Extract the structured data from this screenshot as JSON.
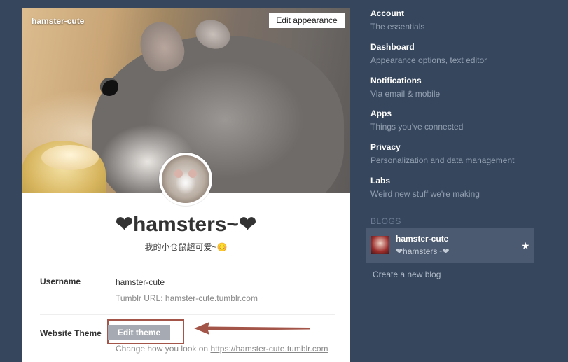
{
  "blog_card": {
    "header_name": "hamster-cute",
    "edit_appearance_label": "Edit appearance",
    "title": "❤hamsters~❤",
    "description": "我的小仓鼠超可爱~😊",
    "username_label": "Username",
    "username_value": "hamster-cute",
    "tumblr_url_prefix": "Tumblr URL: ",
    "tumblr_url": "hamster-cute.tumblr.com",
    "theme_label": "Website Theme",
    "edit_theme_label": "Edit theme",
    "theme_sub_prefix": "Change how you look on ",
    "theme_sub_link": "https://hamster-cute.tumblr.com"
  },
  "nav": {
    "items": [
      {
        "title": "Account",
        "subtitle": "The essentials"
      },
      {
        "title": "Dashboard",
        "subtitle": "Appearance options, text editor"
      },
      {
        "title": "Notifications",
        "subtitle": "Via email & mobile"
      },
      {
        "title": "Apps",
        "subtitle": "Things you've connected"
      },
      {
        "title": "Privacy",
        "subtitle": "Personalization and data management"
      },
      {
        "title": "Labs",
        "subtitle": "Weird new stuff we're making"
      }
    ],
    "blogs_header": "BLOGS",
    "blog": {
      "name": "hamster-cute",
      "title": "❤hamsters~❤"
    },
    "create_blog": "Create a new blog"
  },
  "colors": {
    "background": "#36465d",
    "annotation": "#a45549",
    "edit_theme_button": "#a6aab2"
  }
}
